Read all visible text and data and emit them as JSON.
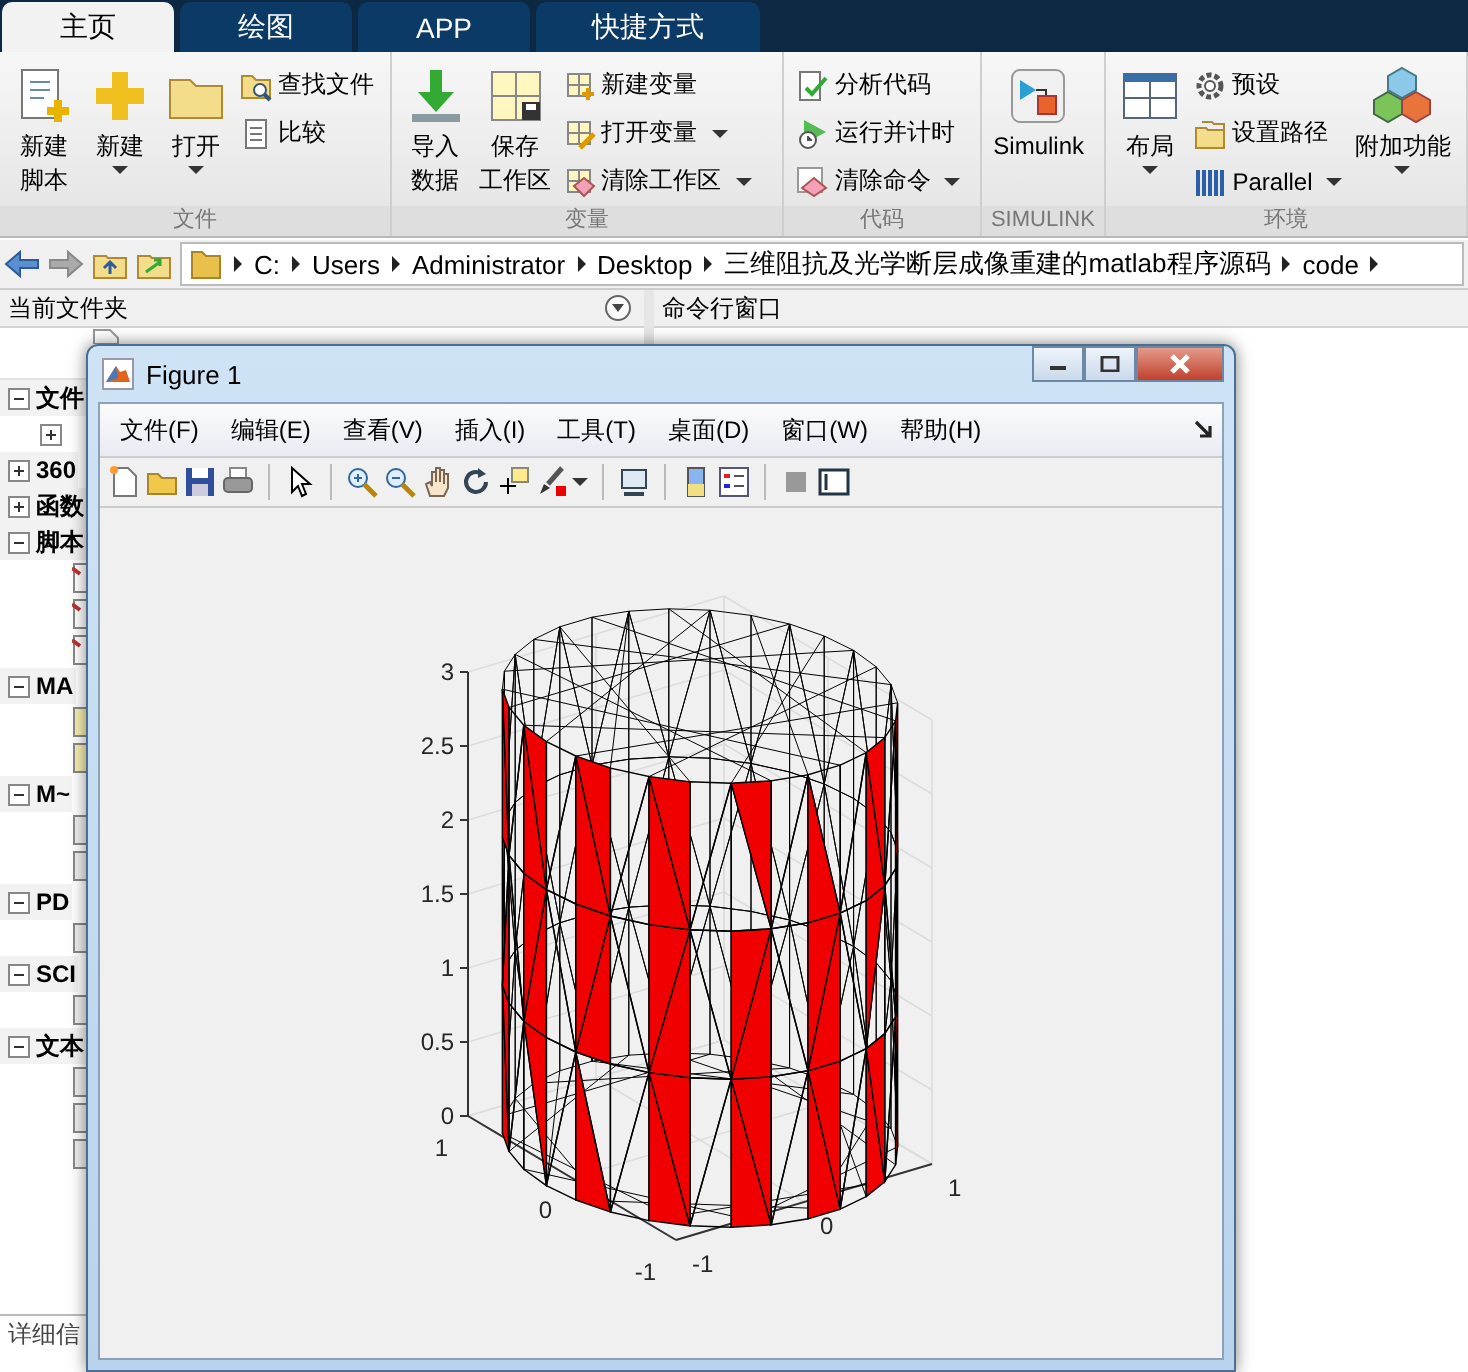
{
  "tabs": [
    {
      "label": "主页",
      "selected": true
    },
    {
      "label": "绘图",
      "selected": false
    },
    {
      "label": "APP",
      "selected": false
    },
    {
      "label": "快捷方式",
      "selected": false
    }
  ],
  "ribbon": {
    "groups": [
      {
        "label": "文件",
        "controls": [
          {
            "kind": "large",
            "lines": [
              "新建",
              "脚本"
            ],
            "dropdown": false
          },
          {
            "kind": "large",
            "lines": [
              "新建"
            ],
            "dropdown": true
          },
          {
            "kind": "large",
            "lines": [
              "打开"
            ],
            "dropdown": true
          },
          {
            "kind": "small",
            "label": "查找文件",
            "dropdown": false
          },
          {
            "kind": "small",
            "label": "比较",
            "dropdown": false
          }
        ]
      },
      {
        "label": "变量",
        "controls": [
          {
            "kind": "large",
            "lines": [
              "导入",
              "数据"
            ],
            "dropdown": false
          },
          {
            "kind": "large",
            "lines": [
              "保存",
              "工作区"
            ],
            "dropdown": false
          },
          {
            "kind": "small",
            "label": "新建变量",
            "dropdown": false
          },
          {
            "kind": "small",
            "label": "打开变量",
            "dropdown": true
          },
          {
            "kind": "small",
            "label": "清除工作区",
            "dropdown": true
          }
        ]
      },
      {
        "label": "代码",
        "controls": [
          {
            "kind": "small",
            "label": "分析代码",
            "dropdown": false
          },
          {
            "kind": "small",
            "label": "运行并计时",
            "dropdown": false
          },
          {
            "kind": "small",
            "label": "清除命令",
            "dropdown": true
          }
        ]
      },
      {
        "label": "SIMULINK",
        "controls": [
          {
            "kind": "large",
            "lines": [
              "Simulink"
            ],
            "dropdown": false
          }
        ]
      },
      {
        "label": "环境",
        "controls": [
          {
            "kind": "large",
            "lines": [
              "布局"
            ],
            "dropdown": true
          },
          {
            "kind": "small",
            "label": "预设",
            "dropdown": false
          },
          {
            "kind": "small",
            "label": "设置路径",
            "dropdown": false
          },
          {
            "kind": "small",
            "label": "Parallel",
            "dropdown": true
          },
          {
            "kind": "large",
            "lines": [
              "附加功能"
            ],
            "dropdown": true
          }
        ]
      }
    ]
  },
  "address_bar": {
    "path": [
      "C:",
      "Users",
      "Administrator",
      "Desktop",
      "三维阻抗及光学断层成像重建的matlab程序源码",
      "code"
    ]
  },
  "current_folder": {
    "title": "当前文件夹",
    "tree": [
      {
        "label": "文件",
        "expanded": true,
        "children": [
          {
            "expanded": false
          }
        ]
      },
      {
        "label": "360",
        "expanded": false
      },
      {
        "label": "函数",
        "expanded": false
      },
      {
        "label": "脚本",
        "expanded": true,
        "children": [
          {
            "kind": "script"
          },
          {
            "kind": "script"
          },
          {
            "kind": "script"
          }
        ]
      },
      {
        "label": "MA",
        "expanded": true,
        "children": [
          {
            "kind": "data"
          },
          {
            "kind": "data"
          }
        ]
      },
      {
        "label": "M~",
        "expanded": true,
        "children": [
          {
            "kind": "file"
          },
          {
            "kind": "file"
          }
        ]
      },
      {
        "label": "PD",
        "expanded": true,
        "children": [
          {
            "kind": "file"
          }
        ]
      },
      {
        "label": "SCI",
        "expanded": true,
        "children": [
          {
            "kind": "file"
          }
        ]
      },
      {
        "label": "文本",
        "expanded": true,
        "children": [
          {
            "kind": "file"
          },
          {
            "kind": "file"
          },
          {
            "kind": "file"
          }
        ]
      }
    ],
    "details_title": "详细信"
  },
  "command_window": {
    "title": "命令行窗口"
  },
  "figure": {
    "title": "Figure 1",
    "menu": [
      "文件(F)",
      "编辑(E)",
      "查看(V)",
      "插入(I)",
      "工具(T)",
      "桌面(D)",
      "窗口(W)",
      "帮助(H)"
    ],
    "plot": {
      "z_ticks": [
        "3",
        "2.5",
        "2",
        "1.5",
        "1",
        "0.5",
        "0"
      ],
      "left_axis_ticks": [
        "1",
        "0",
        "-1"
      ],
      "right_axis_ticks": [
        "-1",
        "0",
        "1"
      ]
    }
  }
}
